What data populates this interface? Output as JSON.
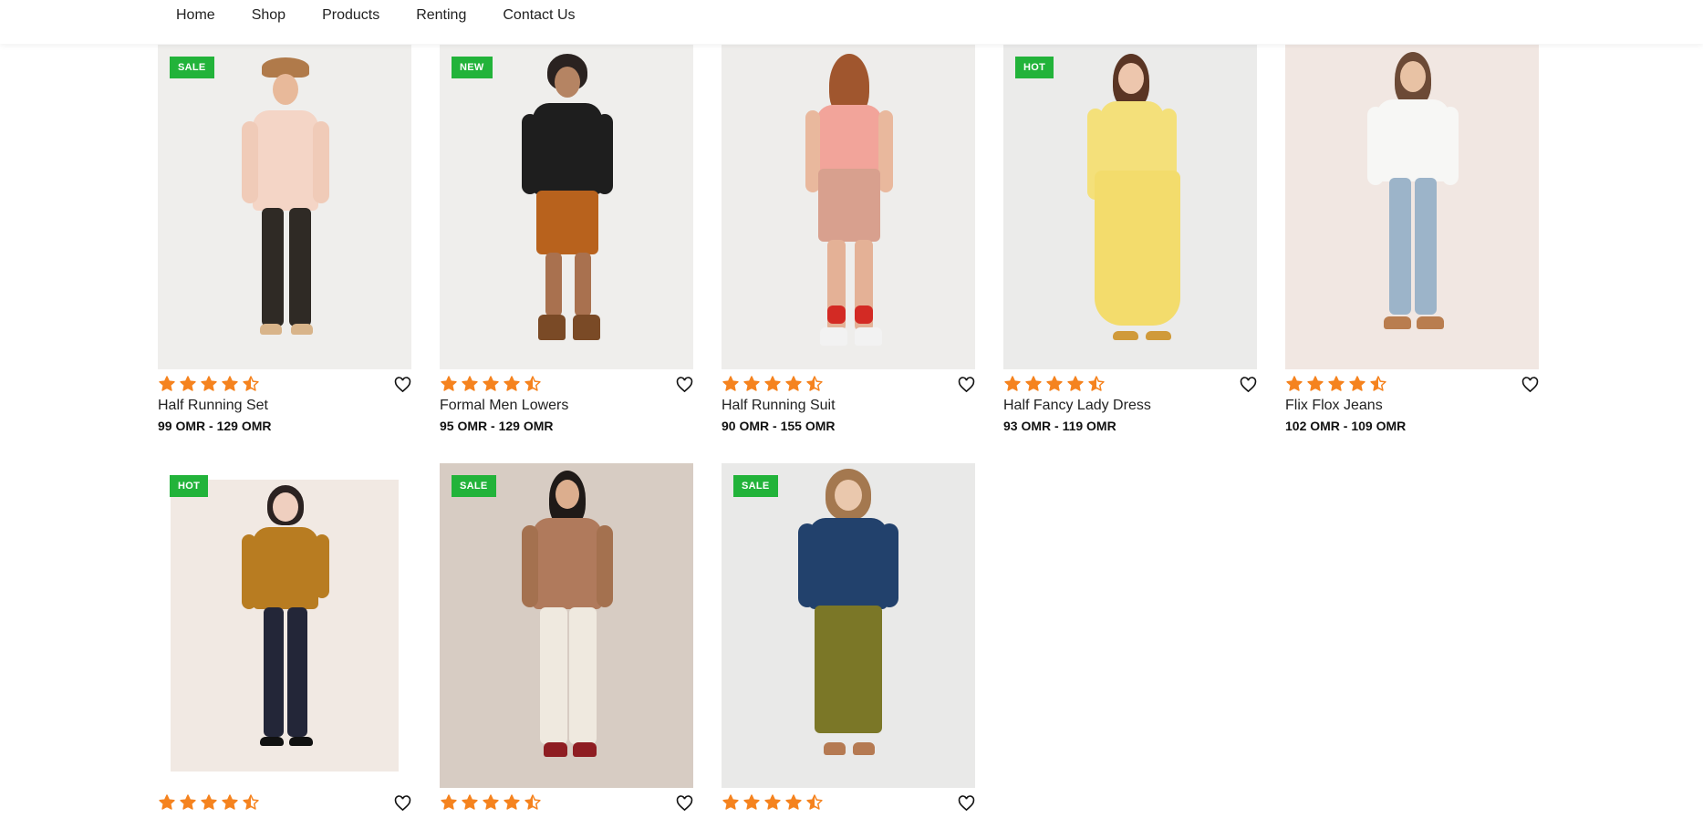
{
  "nav": {
    "items": [
      "Home",
      "Shop",
      "Products",
      "Renting",
      "Contact Us"
    ]
  },
  "colors": {
    "badge": "#22b33a",
    "star": "#f5831f",
    "text": "#111111"
  },
  "icons": {
    "star": "star-icon",
    "half_star": "half-star-icon",
    "wishlist": "heart-icon"
  },
  "products": [
    {
      "badge": "SALE",
      "name": "Half Running Set",
      "price": "99 OMR - 129 OMR",
      "rating": 4.5
    },
    {
      "badge": "NEW",
      "name": "Formal Men Lowers",
      "price": "95 OMR - 129 OMR",
      "rating": 4.5
    },
    {
      "badge": "",
      "name": "Half Running Suit",
      "price": "90 OMR - 155 OMR",
      "rating": 4.5
    },
    {
      "badge": "HOT",
      "name": "Half Fancy Lady Dress",
      "price": "93 OMR - 119 OMR",
      "rating": 4.5
    },
    {
      "badge": "",
      "name": "Flix Flox Jeans",
      "price": "102 OMR - 109 OMR",
      "rating": 4.5
    },
    {
      "badge": "HOT",
      "name": "",
      "price": "",
      "rating": 4.5
    },
    {
      "badge": "SALE",
      "name": "",
      "price": "",
      "rating": 4.5
    },
    {
      "badge": "SALE",
      "name": "",
      "price": "",
      "rating": 4.5
    }
  ]
}
